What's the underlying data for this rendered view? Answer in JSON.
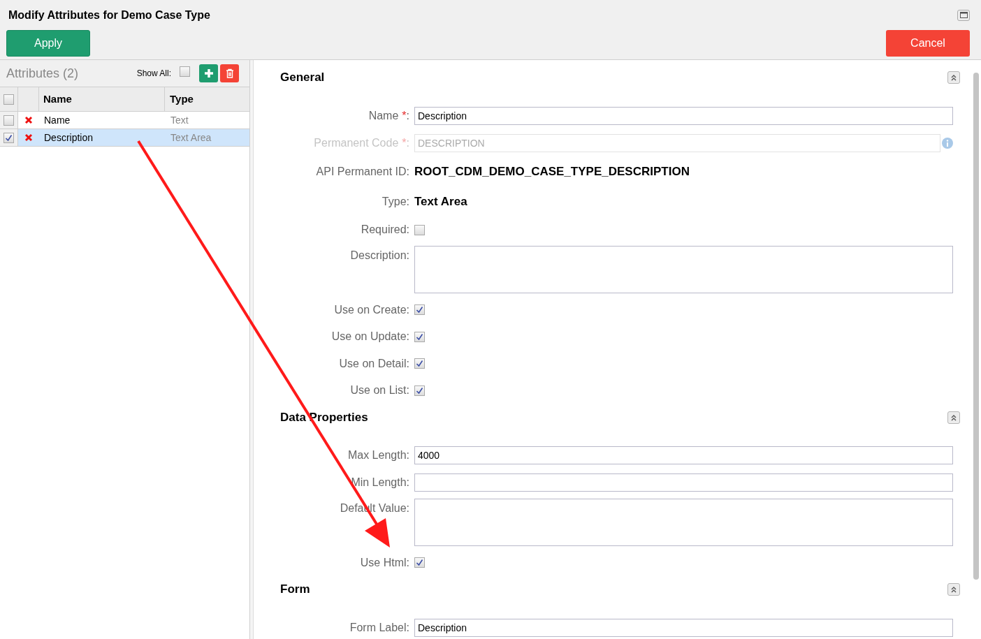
{
  "window": {
    "title": "Modify Attributes for Demo Case Type"
  },
  "toolbar": {
    "apply": "Apply",
    "cancel": "Cancel"
  },
  "attributes": {
    "title": "Attributes (2)",
    "show_all_label": "Show All:",
    "show_all_checked": false,
    "all_checked": false,
    "columns": [
      "Name",
      "Type"
    ],
    "rows": [
      {
        "name": "Name",
        "type": "Text",
        "checked": false,
        "selected": false
      },
      {
        "name": "Description",
        "type": "Text Area",
        "checked": true,
        "selected": true
      }
    ]
  },
  "sections": [
    {
      "title": "General",
      "fields": [
        {
          "kind": "text",
          "label": "Name",
          "required_mark": "*",
          "colon": ":",
          "value": "Description"
        },
        {
          "kind": "text",
          "label": "Permanent Code",
          "required_mark": "*",
          "colon": ":",
          "value": "DESCRIPTION",
          "disabled": true,
          "info": true
        },
        {
          "kind": "readonly",
          "label": "API Permanent ID:",
          "value": "ROOT_CDM_DEMO_CASE_TYPE_DESCRIPTION"
        },
        {
          "kind": "readonly",
          "label": "Type:",
          "value": "Text Area"
        },
        {
          "kind": "checkbox",
          "label": "Required:",
          "checked": false
        },
        {
          "kind": "textarea",
          "label": "Description:"
        },
        {
          "kind": "checkbox",
          "label": "Use on Create:",
          "checked": true
        },
        {
          "kind": "checkbox",
          "label": "Use on Update:",
          "checked": true
        },
        {
          "kind": "checkbox",
          "label": "Use on Detail:",
          "checked": true
        },
        {
          "kind": "checkbox",
          "label": "Use on List:",
          "checked": true
        }
      ]
    },
    {
      "title": "Data Properties",
      "fields": [
        {
          "kind": "text",
          "label": "Max Length:",
          "value": "4000"
        },
        {
          "kind": "text",
          "label": "Min Length:"
        },
        {
          "kind": "textarea",
          "label": "Default Value:"
        },
        {
          "kind": "checkbox",
          "label": "Use Html:",
          "checked": true
        }
      ]
    },
    {
      "title": "Form",
      "fields": [
        {
          "kind": "text",
          "label": "Form Label:",
          "value": "Description"
        }
      ]
    }
  ]
}
